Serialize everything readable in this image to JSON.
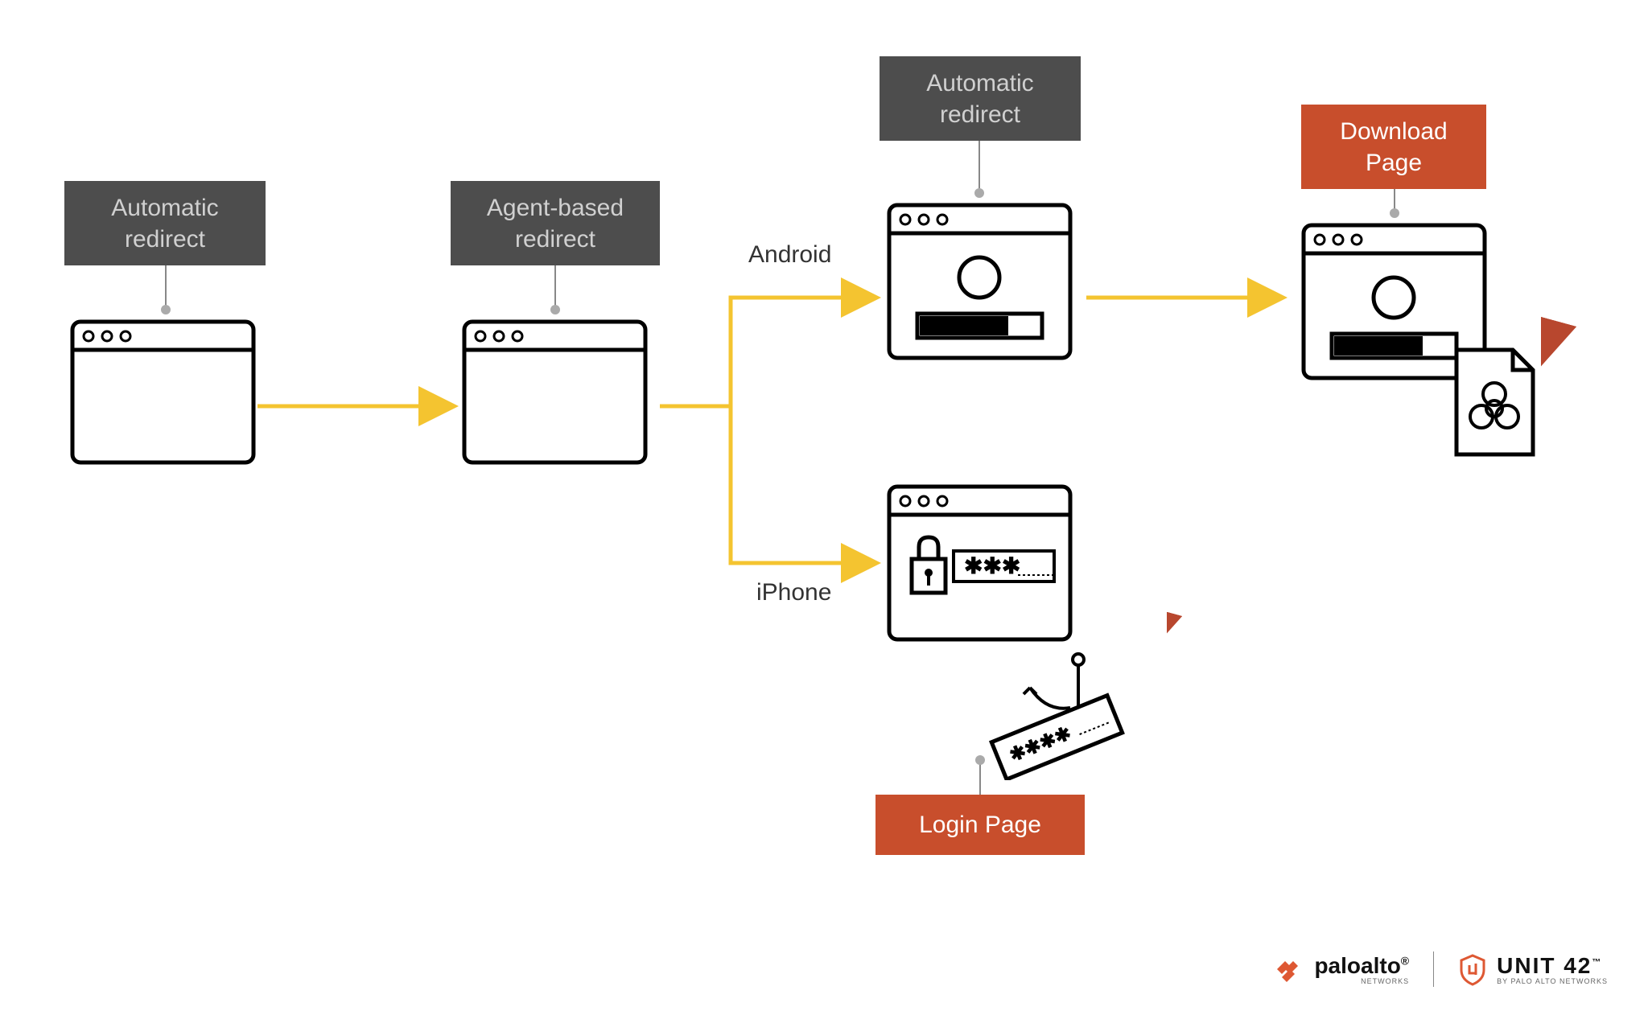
{
  "labels": {
    "auto_redirect_1": "Automatic\nredirect",
    "agent_redirect": "Agent-based\nredirect",
    "auto_redirect_2": "Automatic\nredirect",
    "download_page": "Download\nPage",
    "login_page": "Login Page"
  },
  "paths": {
    "android": "Android",
    "iphone": "iPhone"
  },
  "logos": {
    "paloalto": "paloalto",
    "paloalto_sub": "NETWORKS",
    "unit42": "UNIT 42",
    "unit42_sub": "BY PALO ALTO NETWORKS"
  },
  "colors": {
    "dark_box": "#4d4d4d",
    "orange_box": "#c84e2c",
    "arrow": "#f4c430",
    "red_arrow": "#b8472e"
  }
}
